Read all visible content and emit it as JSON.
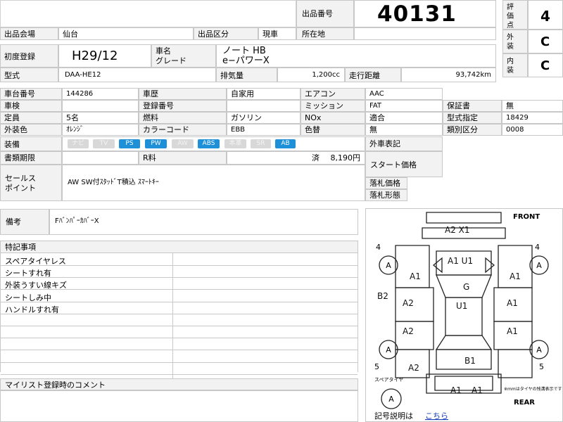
{
  "header": {
    "lot_label": "出品番号",
    "lot_number": "40131",
    "rating_label": "評価点",
    "rating": "4",
    "exterior_label": "外装",
    "exterior_grade": "C",
    "interior_label": "内装",
    "interior_grade": "C"
  },
  "row_venue": {
    "venue_label": "出品会場",
    "venue": "仙台",
    "category_label": "出品区分",
    "category": "現車",
    "location_label": "所在地",
    "location": ""
  },
  "row_reg": {
    "first_reg_label": "初度登録",
    "first_reg": "H29/12",
    "car_name_label": "車名",
    "grade_label": "グレード",
    "car_name": "ノート HB",
    "grade": "e−パワーX"
  },
  "row_model": {
    "model_label": "型式",
    "model": "DAA-HE12",
    "displacement_label": "排気量",
    "displacement": "1,200cc",
    "mileage_label": "走行距離",
    "mileage": "93,742km"
  },
  "specs": {
    "chassis_label": "車台番号",
    "chassis": "144286",
    "history_label": "車歴",
    "history": "自家用",
    "aircon_label": "エアコン",
    "aircon": "AAC",
    "inspection_label": "車検",
    "inspection": "",
    "regno_label": "登録番号",
    "regno": "",
    "mission_label": "ミッション",
    "mission": "FAT",
    "warranty_label": "保証書",
    "warranty": "無",
    "capacity_label": "定員",
    "capacity": "5名",
    "fuel_label": "燃料",
    "fuel": "ガソリン",
    "nox_label": "NOx",
    "nox": "適合",
    "model_desig_label": "型式指定",
    "model_desig": "18429",
    "color_label": "外装色",
    "color": "ｵﾚﾝｼﾞ",
    "color_code_label": "カラーコード",
    "color_code": "EBB",
    "color_change_label": "色替",
    "color_change": "無",
    "class_label": "類別区分",
    "class_code": "0008",
    "equipment_label": "装備",
    "docs_label": "書類期限",
    "docs": "",
    "recycle_label": "R料",
    "recycle_status": "済",
    "recycle_fee": "8,190円",
    "foreign_label": "外車表記",
    "foreign": "",
    "sales_label_1": "セールス",
    "sales_label_2": "ポイント",
    "sales_point": "AW SW付ｽﾀｯﾄﾞT積込 ｽﾏｰﾄｷｰ",
    "start_price_label": "スタート価格",
    "start_price": "",
    "win_price_label": "落札価格",
    "win_price": "",
    "win_form_label": "落札形態",
    "win_form": ""
  },
  "equipment": [
    {
      "label": "ナビ",
      "on": false
    },
    {
      "label": "TV",
      "on": false
    },
    {
      "label": "PS",
      "on": true
    },
    {
      "label": "PW",
      "on": true
    },
    {
      "label": "AW",
      "on": false
    },
    {
      "label": "ABS",
      "on": true
    },
    {
      "label": "本革",
      "on": false
    },
    {
      "label": "SR",
      "on": false
    },
    {
      "label": "AB",
      "on": true
    }
  ],
  "remarks": {
    "label": "備考",
    "text": "FﾊﾞﾝﾊﾟｰｶﾊﾞｰX"
  },
  "notes": {
    "label": "特記事項",
    "items": [
      "スペアタイヤレス",
      "シートすれ有",
      "外装うすい線キズ",
      "シートしみ中",
      "ハンドルすれ有",
      "",
      "",
      "",
      "",
      "",
      ""
    ]
  },
  "mylist": {
    "label": "マイリスト登録時のコメント",
    "text": ""
  },
  "diagram": {
    "front": "FRONT",
    "rear": "REAR",
    "tire_fl": "4",
    "tire_fr": "4",
    "tire_rl": "5",
    "tire_rr": "5",
    "spare_label": "スペアタイヤ",
    "note": "※mmはタイヤの残溝表示です",
    "marks": [
      "A2 X1",
      "A1 U1",
      "A1",
      "A1",
      "G",
      "B2",
      "A2",
      "U1",
      "A1",
      "A2",
      "A1",
      "B1",
      "A2",
      "A1",
      "A1"
    ],
    "legend_text": "記号説明は",
    "legend_link": "こちら"
  }
}
